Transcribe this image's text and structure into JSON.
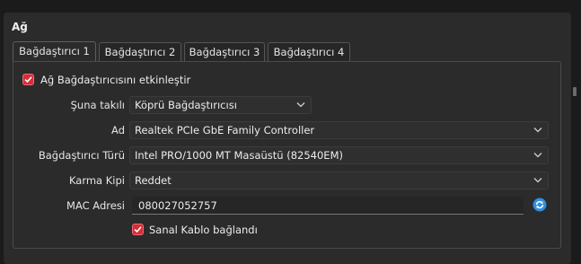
{
  "section": {
    "title": "Ağ"
  },
  "tabs": [
    {
      "label": "Bağdaştırıcı 1",
      "active": true
    },
    {
      "label": "Bağdaştırıcı 2",
      "active": false
    },
    {
      "label": "Bağdaştırıcı 3",
      "active": false
    },
    {
      "label": "Bağdaştırıcı 4",
      "active": false
    }
  ],
  "enable_adapter": {
    "label": "Ağ Bağdaştırıcısını etkinleştir",
    "checked": true
  },
  "attached_to": {
    "label": "Şuna takılı",
    "value": "Köprü Bağdaştırıcısı"
  },
  "name": {
    "label": "Ad",
    "value": "Realtek PCIe GbE Family Controller"
  },
  "adapter_type": {
    "label": "Bağdaştırıcı Türü",
    "value": "Intel PRO/1000 MT Masaüstü (82540EM)"
  },
  "promiscuous": {
    "label": "Karma Kipi",
    "value": "Reddet"
  },
  "mac": {
    "label": "MAC Adresi",
    "value": "080027052757"
  },
  "cable": {
    "label": "Sanal Kablo bağlandı",
    "checked": true
  },
  "colors": {
    "accent": "#d32f3a",
    "background": "#2b2b2b",
    "refresh": "#2f8fe0"
  },
  "icons": [
    "checkmark-icon",
    "chevron-down-icon",
    "refresh-icon"
  ]
}
